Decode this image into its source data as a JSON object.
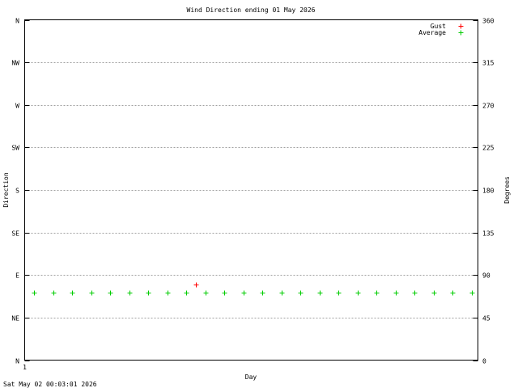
{
  "chart_data": {
    "type": "scatter",
    "title": "Wind Direction ending 01 May 2026",
    "xlabel": "Day",
    "ylabel_left": "Direction",
    "ylabel_right": "Degrees",
    "footer": "Sat May 02 00:03:01 2026",
    "xlim": [
      1,
      24.5
    ],
    "ylim": [
      0,
      360
    ],
    "x_ticks": [
      {
        "value": 1,
        "label": "1"
      }
    ],
    "y_ticks_left": [
      {
        "value": 0,
        "label": "N"
      },
      {
        "value": 45,
        "label": "NE"
      },
      {
        "value": 90,
        "label": "E"
      },
      {
        "value": 135,
        "label": "SE"
      },
      {
        "value": 180,
        "label": "S"
      },
      {
        "value": 225,
        "label": "SW"
      },
      {
        "value": 270,
        "label": "W"
      },
      {
        "value": 315,
        "label": "NW"
      },
      {
        "value": 360,
        "label": "N"
      }
    ],
    "y_ticks_right": [
      {
        "value": 0,
        "label": "0"
      },
      {
        "value": 45,
        "label": "45"
      },
      {
        "value": 90,
        "label": "90"
      },
      {
        "value": 135,
        "label": "135"
      },
      {
        "value": 180,
        "label": "180"
      },
      {
        "value": 225,
        "label": "225"
      },
      {
        "value": 270,
        "label": "270"
      },
      {
        "value": 315,
        "label": "315"
      },
      {
        "value": 360,
        "label": "360"
      }
    ],
    "grid": true,
    "legend_position": "top-right",
    "series": [
      {
        "name": "Gust",
        "color": "#ff0000",
        "points": [
          {
            "x": 10,
            "y": 80
          }
        ]
      },
      {
        "name": "Average",
        "color": "#00cc00",
        "points": [
          {
            "x": 1.5,
            "y": 71
          },
          {
            "x": 2.5,
            "y": 71
          },
          {
            "x": 3.5,
            "y": 71
          },
          {
            "x": 4.5,
            "y": 71
          },
          {
            "x": 5.5,
            "y": 71
          },
          {
            "x": 6.5,
            "y": 71
          },
          {
            "x": 7.5,
            "y": 71
          },
          {
            "x": 8.5,
            "y": 71
          },
          {
            "x": 9.5,
            "y": 71
          },
          {
            "x": 10.5,
            "y": 71
          },
          {
            "x": 11.5,
            "y": 71
          },
          {
            "x": 12.5,
            "y": 71
          },
          {
            "x": 13.5,
            "y": 71
          },
          {
            "x": 14.5,
            "y": 71
          },
          {
            "x": 15.5,
            "y": 71
          },
          {
            "x": 16.5,
            "y": 71
          },
          {
            "x": 17.5,
            "y": 71
          },
          {
            "x": 18.5,
            "y": 71
          },
          {
            "x": 19.5,
            "y": 71
          },
          {
            "x": 20.5,
            "y": 71
          },
          {
            "x": 21.5,
            "y": 71
          },
          {
            "x": 22.5,
            "y": 71
          },
          {
            "x": 23.5,
            "y": 71
          },
          {
            "x": 24.5,
            "y": 71
          }
        ]
      }
    ]
  }
}
